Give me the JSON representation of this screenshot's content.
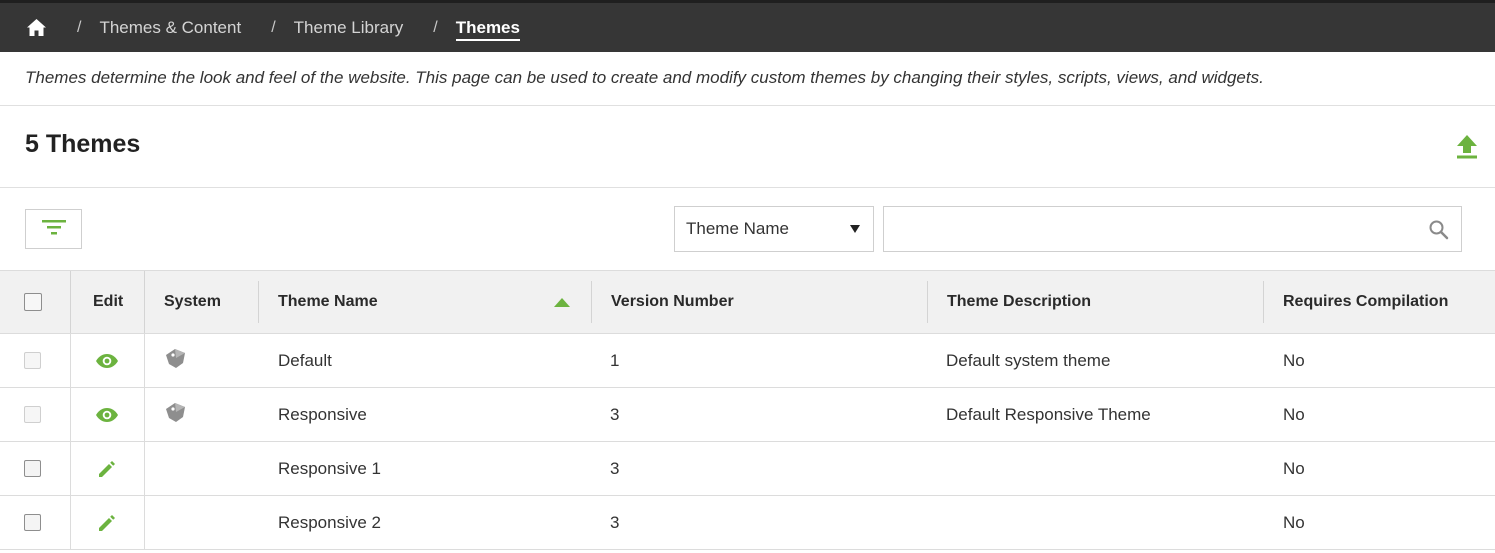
{
  "breadcrumb": {
    "items": [
      "Themes & Content",
      "Theme Library",
      "Themes"
    ],
    "separator": "/"
  },
  "description": "Themes determine the look and feel of the website. This page can be used to create and modify custom themes by changing their styles, scripts, views, and widgets.",
  "header": {
    "count_title": "5 Themes"
  },
  "toolbar": {
    "search_field_select": "Theme Name",
    "search_value": ""
  },
  "table": {
    "columns": [
      "Edit",
      "System",
      "Theme Name",
      "Version Number",
      "Theme Description",
      "Requires Compilation"
    ],
    "sort_column": "Theme Name",
    "sort_direction": "ascending",
    "rows": [
      {
        "name": "Default",
        "version": "1",
        "description": "Default system theme",
        "requires_compilation": "No",
        "system": true,
        "edit_icon": "eye-icon"
      },
      {
        "name": "Responsive",
        "version": "3",
        "description": "Default Responsive Theme",
        "requires_compilation": "No",
        "system": true,
        "edit_icon": "eye-icon"
      },
      {
        "name": "Responsive 1",
        "version": "3",
        "description": "",
        "requires_compilation": "No",
        "system": false,
        "edit_icon": "pencil-icon"
      },
      {
        "name": "Responsive 2",
        "version": "3",
        "description": "",
        "requires_compilation": "No",
        "system": false,
        "edit_icon": "pencil-icon"
      }
    ]
  },
  "colors": {
    "accent": "#6cb33f",
    "topbar": "#363636",
    "header_bg": "#f1f1f1"
  },
  "icons": {
    "home": "home-icon",
    "upload": "upload-icon",
    "filter": "filter-icon",
    "search": "search-icon",
    "dropdown": "chevron-down-icon",
    "sort": "sort-ascending-icon",
    "system": "tag-icon"
  }
}
